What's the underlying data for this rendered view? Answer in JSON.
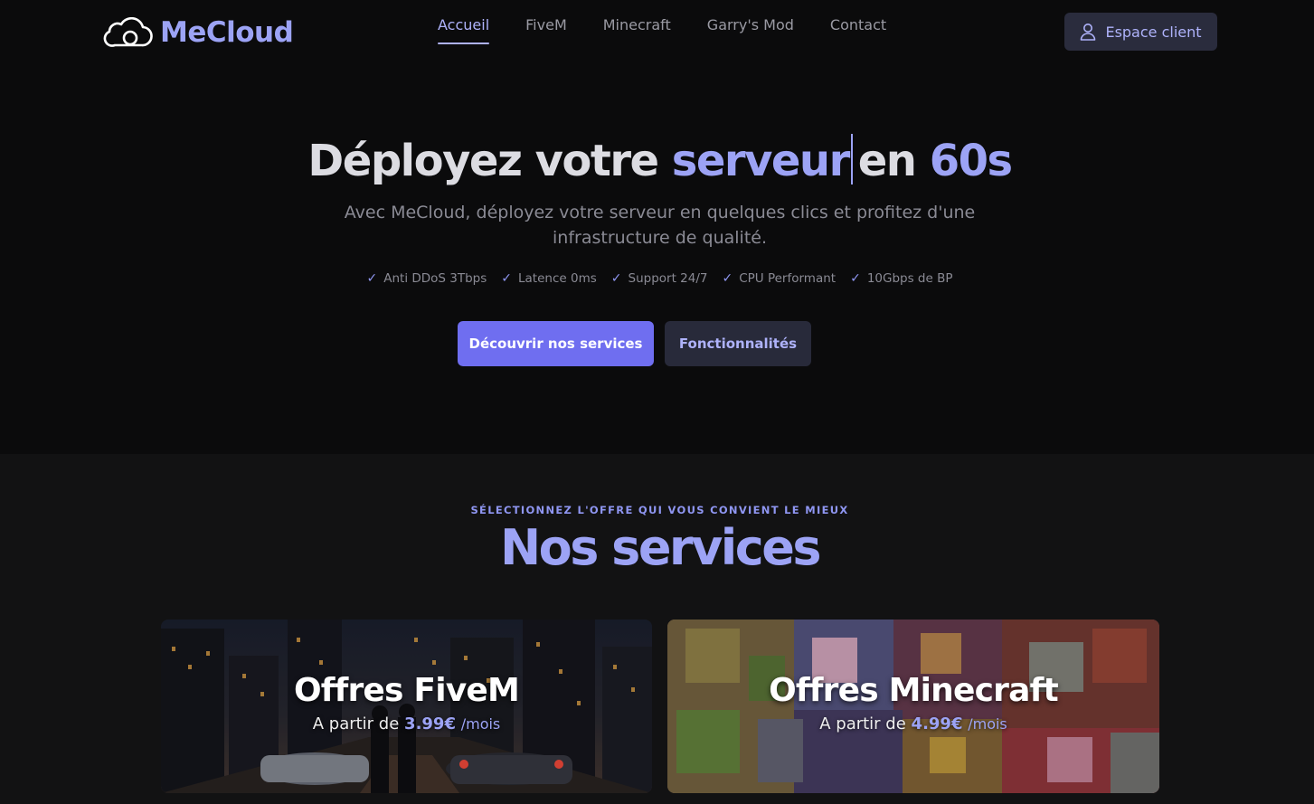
{
  "header": {
    "logo_text": "MeCloud",
    "nav": [
      {
        "label": "Accueil",
        "active": true
      },
      {
        "label": "FiveM",
        "active": false
      },
      {
        "label": "Minecraft",
        "active": false
      },
      {
        "label": "Garry's Mod",
        "active": false
      },
      {
        "label": "Contact",
        "active": false
      }
    ],
    "client_button": "Espace client"
  },
  "hero": {
    "title_part1": "Déployez votre",
    "title_highlight": "serveur",
    "title_part2": "en",
    "title_accent": "60s",
    "subtitle": "Avec MeCloud, déployez votre serveur en quelques clics et profitez d'une infrastructure de qualité.",
    "features": [
      "Anti DDoS 3Tbps",
      "Latence 0ms",
      "Support 24/7",
      "CPU Performant",
      "10Gbps de BP"
    ],
    "primary_button": "Découvrir nos services",
    "secondary_button": "Fonctionnalités"
  },
  "services": {
    "eyebrow": "SÉLECTIONNEZ L'OFFRE QUI VOUS CONVIENT LE MIEUX",
    "title": "Nos services",
    "cards": [
      {
        "title": "Offres FiveM",
        "price_prefix": "A partir de",
        "price": "3.99€",
        "period": "/mois"
      },
      {
        "title": "Offres Minecraft",
        "price_prefix": "A partir de",
        "price": "4.99€",
        "period": "/mois"
      }
    ]
  },
  "colors": {
    "accent": "#9ca3f5",
    "primary_button": "#6f6ef0",
    "background": "#0b0b0c",
    "section_background": "#121213"
  },
  "icons": [
    "cloud-logo-icon",
    "user-icon",
    "check-icon"
  ]
}
